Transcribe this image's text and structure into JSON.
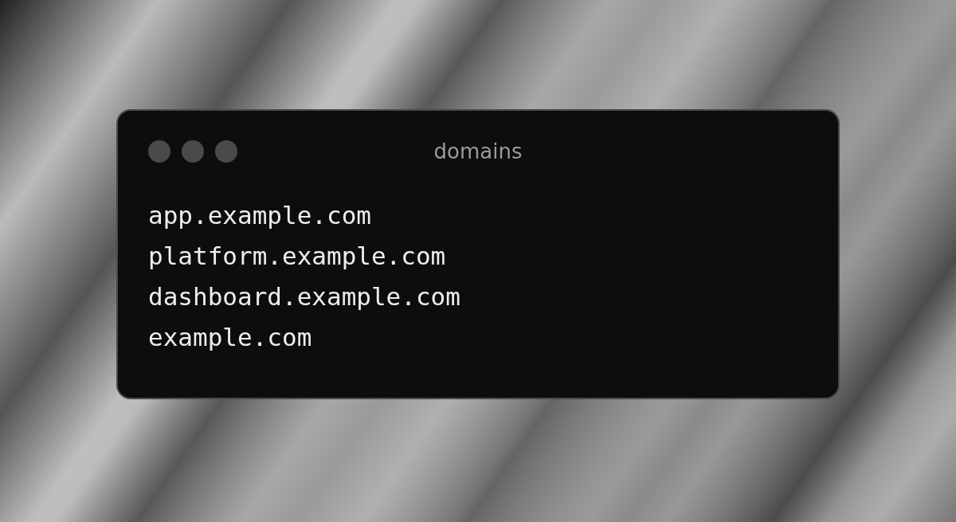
{
  "window": {
    "title": "domains"
  },
  "lines": [
    "app.example.com",
    "platform.example.com",
    "dashboard.example.com",
    "example.com"
  ]
}
